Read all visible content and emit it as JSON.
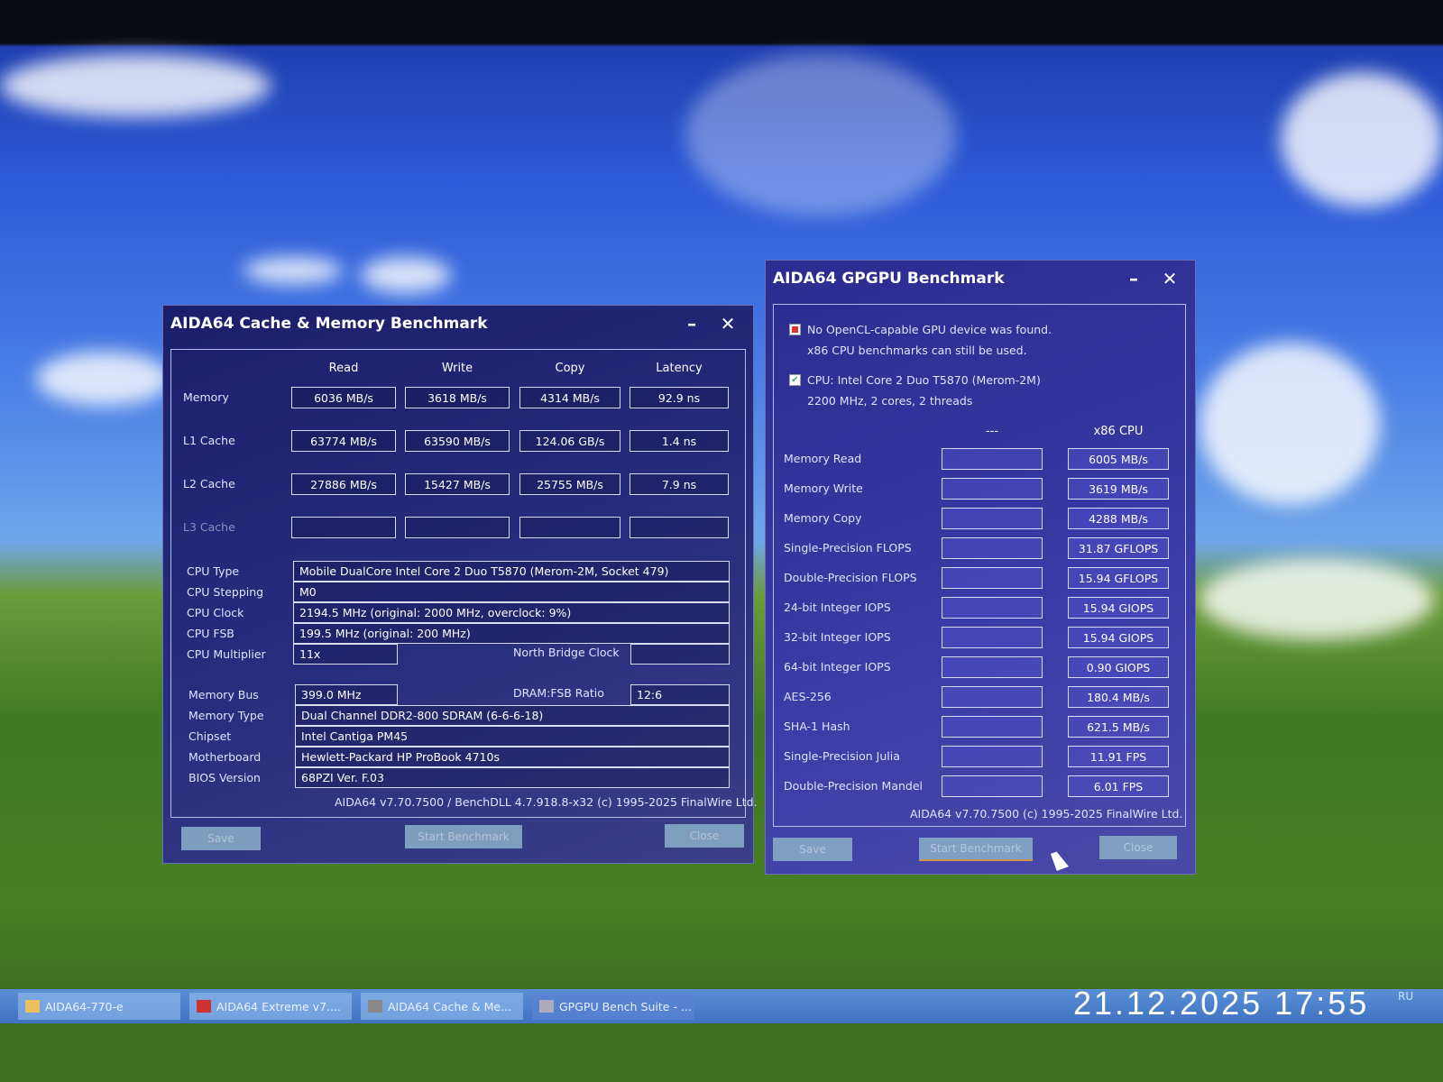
{
  "cache_window": {
    "title": "AIDA64 Cache & Memory Benchmark",
    "columns": [
      "Read",
      "Write",
      "Copy",
      "Latency"
    ],
    "rows": [
      {
        "label": "Memory",
        "values": [
          "6036 MB/s",
          "3618 MB/s",
          "4314 MB/s",
          "92.9 ns"
        ]
      },
      {
        "label": "L1 Cache",
        "values": [
          "63774 MB/s",
          "63590 MB/s",
          "124.06 GB/s",
          "1.4 ns"
        ]
      },
      {
        "label": "L2 Cache",
        "values": [
          "27886 MB/s",
          "15427 MB/s",
          "25755 MB/s",
          "7.9 ns"
        ]
      },
      {
        "label": "L3 Cache",
        "values": [
          "",
          "",
          "",
          ""
        ]
      }
    ],
    "info": [
      {
        "label": "CPU Type",
        "value": "Mobile DualCore Intel Core 2 Duo T5870  (Merom-2M, Socket 479)"
      },
      {
        "label": "CPU Stepping",
        "value": "M0"
      },
      {
        "label": "CPU Clock",
        "value": "2194.5 MHz  (original: 2000 MHz, overclock: 9%)"
      },
      {
        "label": "CPU FSB",
        "value": "199.5 MHz  (original: 200 MHz)"
      }
    ],
    "cpu_multiplier": {
      "label": "CPU Multiplier",
      "value": "11x"
    },
    "north_bridge": {
      "label": "North Bridge Clock",
      "value": ""
    },
    "memory_bus": {
      "label": "Memory Bus",
      "value": "399.0 MHz"
    },
    "dram_ratio": {
      "label": "DRAM:FSB Ratio",
      "value": "12:6"
    },
    "info2": [
      {
        "label": "Memory Type",
        "value": "Dual Channel DDR2-800 SDRAM  (6-6-6-18)"
      },
      {
        "label": "Chipset",
        "value": "Intel Cantiga PM45"
      },
      {
        "label": "Motherboard",
        "value": "Hewlett-Packard HP ProBook 4710s"
      },
      {
        "label": "BIOS Version",
        "value": "68PZI Ver. F.03"
      }
    ],
    "footer": "AIDA64 v7.70.7500 / BenchDLL 4.7.918.8-x32  (c) 1995-2025 FinalWire Ltd.",
    "buttons": {
      "save": "Save",
      "start": "Start Benchmark",
      "close": "Close"
    }
  },
  "gpgpu_window": {
    "title": "AIDA64 GPGPU Benchmark",
    "notice1": "No OpenCL-capable GPU device was found.",
    "notice2": "x86 CPU benchmarks can still be used.",
    "cpu_line1": "CPU: Intel Core 2 Duo T5870 (Merom-2M)",
    "cpu_line2": "2200 MHz, 2 cores, 2 threads",
    "col_gpu": "---",
    "col_cpu": "x86 CPU",
    "rows": [
      {
        "label": "Memory Read",
        "gpu": "",
        "cpu": "6005 MB/s"
      },
      {
        "label": "Memory Write",
        "gpu": "",
        "cpu": "3619 MB/s"
      },
      {
        "label": "Memory Copy",
        "gpu": "",
        "cpu": "4288 MB/s"
      },
      {
        "label": "Single-Precision FLOPS",
        "gpu": "",
        "cpu": "31.87 GFLOPS"
      },
      {
        "label": "Double-Precision FLOPS",
        "gpu": "",
        "cpu": "15.94 GFLOPS"
      },
      {
        "label": "24-bit Integer IOPS",
        "gpu": "",
        "cpu": "15.94 GIOPS"
      },
      {
        "label": "32-bit Integer IOPS",
        "gpu": "",
        "cpu": "15.94 GIOPS"
      },
      {
        "label": "64-bit Integer IOPS",
        "gpu": "",
        "cpu": "0.90 GIOPS"
      },
      {
        "label": "AES-256",
        "gpu": "",
        "cpu": "180.4 MB/s"
      },
      {
        "label": "SHA-1 Hash",
        "gpu": "",
        "cpu": "621.5 MB/s"
      },
      {
        "label": "Single-Precision Julia",
        "gpu": "",
        "cpu": "11.91 FPS"
      },
      {
        "label": "Double-Precision Mandel",
        "gpu": "",
        "cpu": "6.01 FPS"
      }
    ],
    "footer": "AIDA64 v7.70.7500  (c) 1995-2025 FinalWire Ltd.",
    "buttons": {
      "save": "Save",
      "start": "Start Benchmark",
      "close": "Close"
    }
  },
  "taskbar": {
    "items": [
      "AIDA64-770-e",
      "AIDA64 Extreme v7....",
      "AIDA64 Cache & Me...",
      "GPGPU Bench Suite - ..."
    ],
    "lang": "RU"
  },
  "photo_timestamp": "21.12.2025 17:55"
}
